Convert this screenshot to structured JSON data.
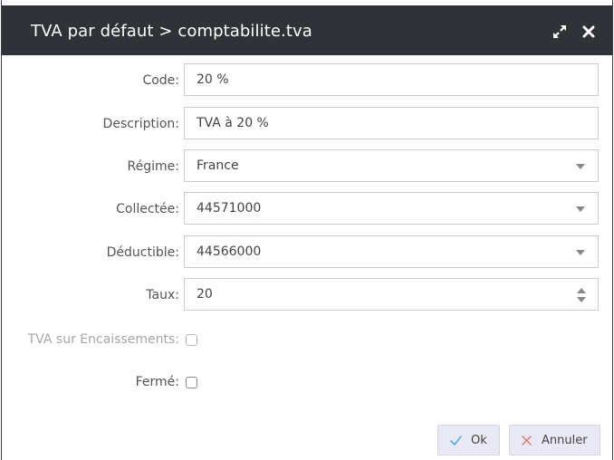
{
  "window": {
    "title": "TVA par défaut > comptabilite.tva"
  },
  "form": {
    "code": {
      "label": "Code:",
      "value": "20 %"
    },
    "description": {
      "label": "Description:",
      "value": "TVA à 20 %"
    },
    "regime": {
      "label": "Régime:",
      "value": "France"
    },
    "collectee": {
      "label": "Collectée:",
      "value": "44571000"
    },
    "deductible": {
      "label": "Déductible:",
      "value": "44566000"
    },
    "taux": {
      "label": "Taux:",
      "value": "20"
    },
    "tva_encaissements": {
      "label": "TVA sur Encaissements:",
      "checked": false
    },
    "ferme": {
      "label": "Fermé:",
      "checked": false
    }
  },
  "actions": {
    "ok_label": "Ok",
    "cancel_label": "Annuler"
  },
  "colors": {
    "titlebar": "#2f3338",
    "button_bg": "#e9e9f6",
    "ok_check": "#5aa9e6",
    "cancel_x": "#e57373"
  }
}
